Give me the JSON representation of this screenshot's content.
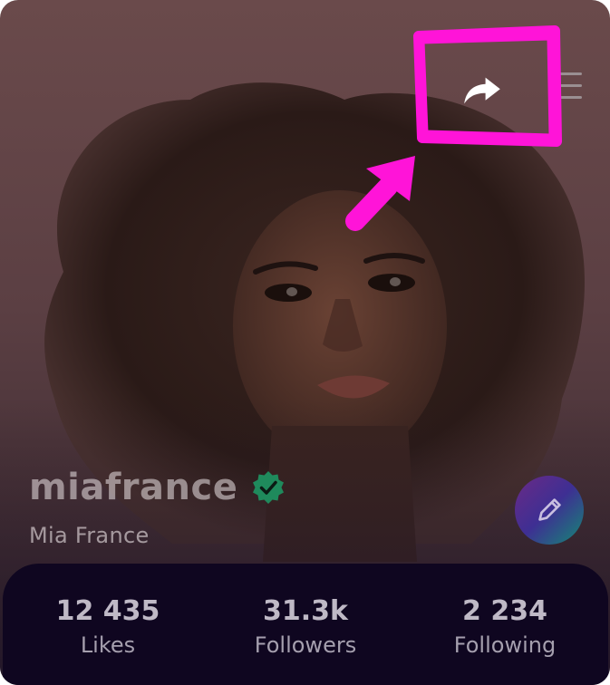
{
  "profile": {
    "username": "miafrance",
    "display_name": "Mia France",
    "verified": true
  },
  "stats": [
    {
      "value": "12 435",
      "label": "Likes"
    },
    {
      "value": "31.3k",
      "label": "Followers"
    },
    {
      "value": "2 234",
      "label": "Following"
    }
  ],
  "icons": {
    "share": "share-arrow-icon",
    "menu": "hamburger-menu-icon",
    "verified": "verified-badge-icon",
    "edit": "pencil-icon"
  },
  "colors": {
    "annotation": "#ff14d8",
    "verified_badge": "#1f8a5c",
    "stats_panel": "#0f0620",
    "edit_gradient_start": "#6b2a86",
    "edit_gradient_end": "#148a74"
  }
}
